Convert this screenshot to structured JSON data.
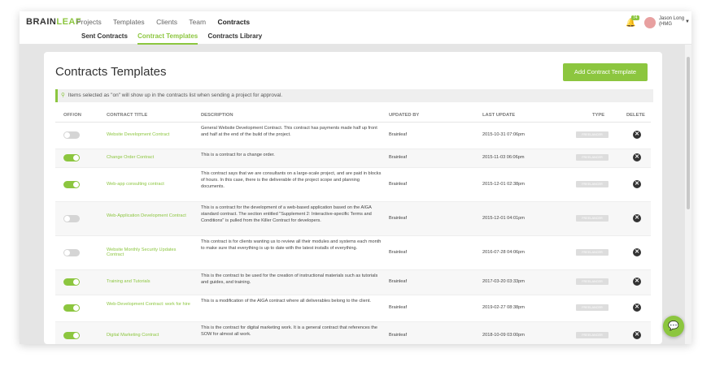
{
  "app": {
    "logo_part1": "BRAIN",
    "logo_part2": "LEAF"
  },
  "nav": {
    "items": [
      "Projects",
      "Templates",
      "Clients",
      "Team",
      "Contracts"
    ]
  },
  "subnav": {
    "items": [
      "Sent Contracts",
      "Contract Templates",
      "Contracts Library"
    ]
  },
  "user": {
    "name_line1": "Jason Long",
    "name_line2": "(HMG",
    "notification_count": "74"
  },
  "page": {
    "title": "Contracts Templates",
    "add_button": "Add Contract Template",
    "notice": "Items selected as \"on\" will show up in the contracts list when sending a project for approval."
  },
  "table": {
    "headers": [
      "OFF/ON",
      "CONTRACT TITLE",
      "DESCRIPTION",
      "UPDATED BY",
      "LAST UPDATE",
      "TYPE",
      "DELETE"
    ],
    "rows": [
      {
        "on": false,
        "title": "Website Development Contract",
        "description": "General Website Development Contract. This contract has payments made half up front and half at the end of the build of the project.",
        "updated_by": "Brainleaf",
        "last_update": "2015-10-31 07:06pm",
        "type": "FREELANCER"
      },
      {
        "on": true,
        "title": "Change Order Contract",
        "description": "This is a contract for a change order.",
        "updated_by": "Brainleaf",
        "last_update": "2015-11-03 06:06pm",
        "type": "FREELANCER"
      },
      {
        "on": true,
        "title": "Web-app consulting contract",
        "description": "This contract says that we are consultants on a large-scale project, and are paid in blocks of hours. In this case, there is the deliverable of the project scope and planning documents.",
        "updated_by": "Brainleaf",
        "last_update": "2015-12-01 02:38pm",
        "type": "FREELANCER"
      },
      {
        "on": false,
        "title": "Web-Application Development Contract",
        "description": "This is a contract for the development of a web-based application based on the AIGA standard contract. The section entitled \"Supplement 2: Interactive-specific Terms and Conditions\" is pulled from the Killer Contract for developers.",
        "updated_by": "Brainleaf",
        "last_update": "2015-12-01 04:01pm",
        "type": "FREELANCER"
      },
      {
        "on": false,
        "title": "Website Monthly Security Updates Contract",
        "description": "This contract is for clients wanting us to review all their modules and systems each month to make sure that everything is up to date with the latest installs of everything.",
        "updated_by": "Brainleaf",
        "last_update": "2016-07-28 04:06pm",
        "type": "FREELANCER"
      },
      {
        "on": true,
        "title": "Training and Tutorials",
        "description": "This is the contract to be used for the creation of instructional materials such as tutorials and guides, and training.",
        "updated_by": "Brainleaf",
        "last_update": "2017-03-20 03:33pm",
        "type": "FREELANCER"
      },
      {
        "on": true,
        "title": "Web-Development Contract: work for hire",
        "description": "This is a modification of the AIGA contract where all deliverables belong to the client.",
        "updated_by": "Brainleaf",
        "last_update": "2019-02-27 08:38pm",
        "type": "FREELANCER"
      },
      {
        "on": true,
        "title": "Digital Marketing Contract",
        "description": "This is the contract for digital marketing work. It is a general contract that references the SOW for almost all work.",
        "updated_by": "Brainleaf",
        "last_update": "2018-10-09 03:00pm",
        "type": "FREELANCER"
      }
    ]
  },
  "colors": {
    "accent": "#8cc63f",
    "delete": "#333333"
  }
}
